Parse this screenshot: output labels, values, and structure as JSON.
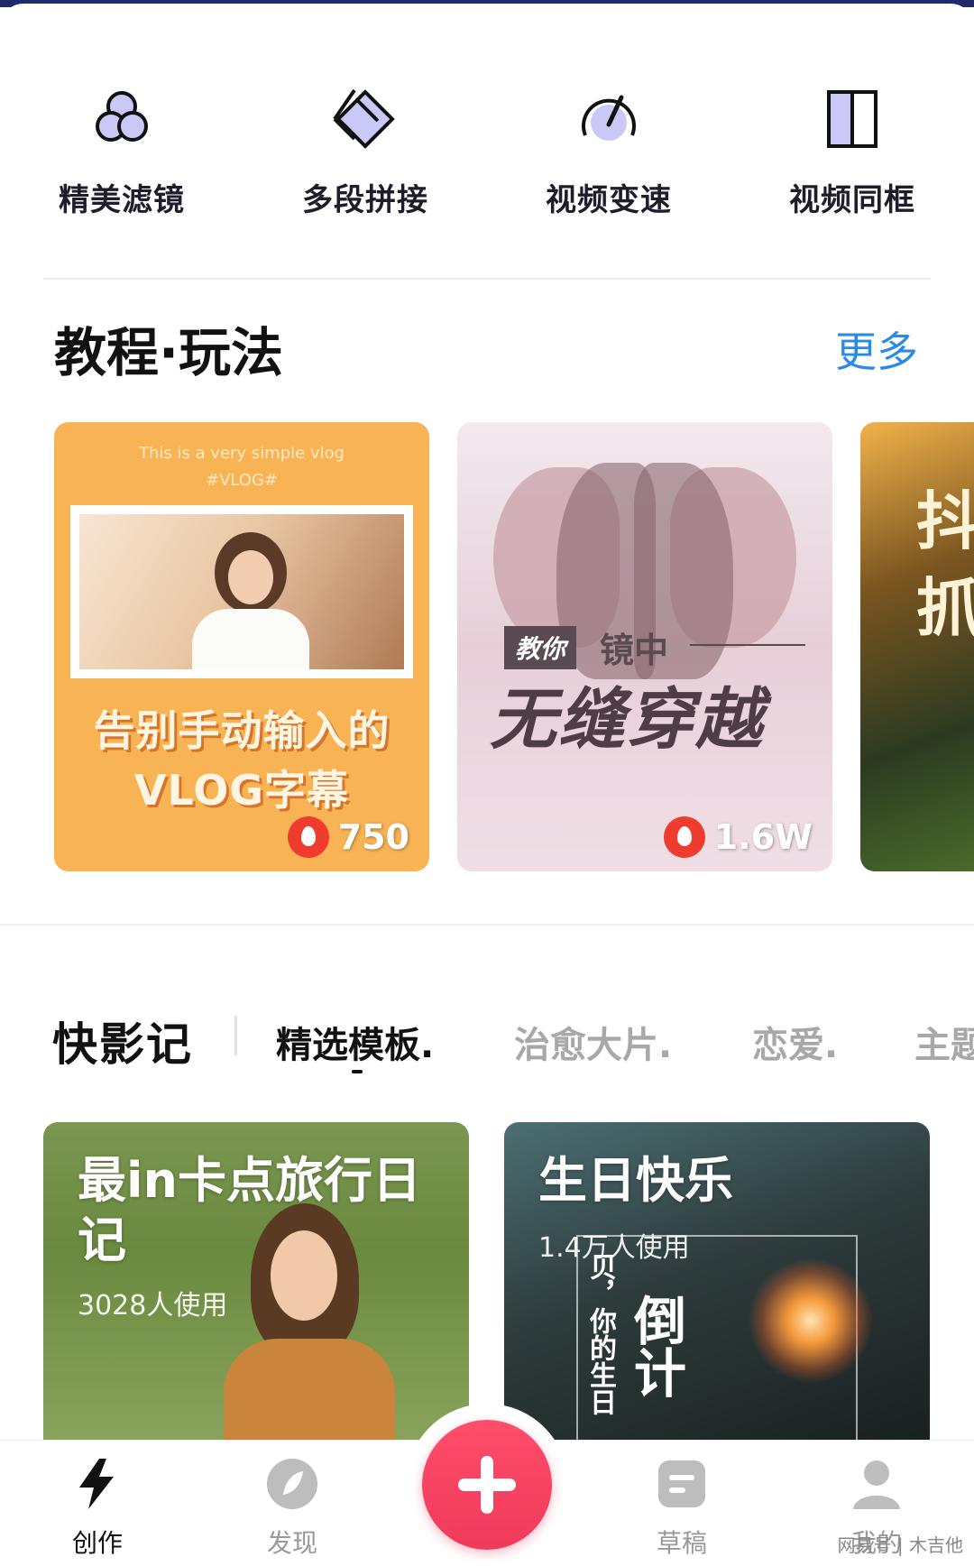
{
  "tools": [
    {
      "label": "精美滤镜",
      "icon": "filter-circles-icon"
    },
    {
      "label": "多段拼接",
      "icon": "splice-diamond-icon"
    },
    {
      "label": "视频变速",
      "icon": "speed-gauge-icon"
    },
    {
      "label": "视频同框",
      "icon": "split-frame-icon"
    }
  ],
  "tutorials": {
    "title": "教程·玩法",
    "more": "更多",
    "cards": [
      {
        "small_line1": "This is a very simple vlog",
        "small_line2": "#VLOG#",
        "line1": "告别手动输入的",
        "line2": "VLOG字幕",
        "count": "750"
      },
      {
        "tag": "教你",
        "sub": "镜中",
        "big": "无缝穿越",
        "count": "1.6W"
      },
      {
        "line1": "抖",
        "line2": "抓"
      }
    ]
  },
  "templates": {
    "brand": "快影记",
    "tabs": [
      {
        "label": "精选模板.",
        "active": true
      },
      {
        "label": "治愈大片.",
        "active": false
      },
      {
        "label": "恋爱.",
        "active": false
      },
      {
        "label": "主题",
        "active": false
      }
    ],
    "cards": [
      {
        "title_line1": "最in卡点旅行日",
        "title_line2": "记",
        "uses": "3028人使用"
      },
      {
        "title_line1": "生日快乐",
        "uses": "1.4万人使用",
        "vert_small": "贝，你的生日",
        "vert_big": "倒计"
      }
    ]
  },
  "nav": {
    "items": [
      {
        "label": "创作",
        "icon": "lightning-icon",
        "active": true
      },
      {
        "label": "发现",
        "icon": "compass-icon",
        "active": false
      },
      {
        "label": "草稿",
        "icon": "draft-icon",
        "active": false
      },
      {
        "label": "我的",
        "icon": "profile-icon",
        "active": false
      }
    ],
    "watermark": "网易号 | 木吉他"
  },
  "colors": {
    "accent_blue": "#2b8ae6",
    "fab_pink": "#f03a5c",
    "icon_lavender": "#c9c8f6",
    "tutorial_orange": "#f8b354"
  }
}
